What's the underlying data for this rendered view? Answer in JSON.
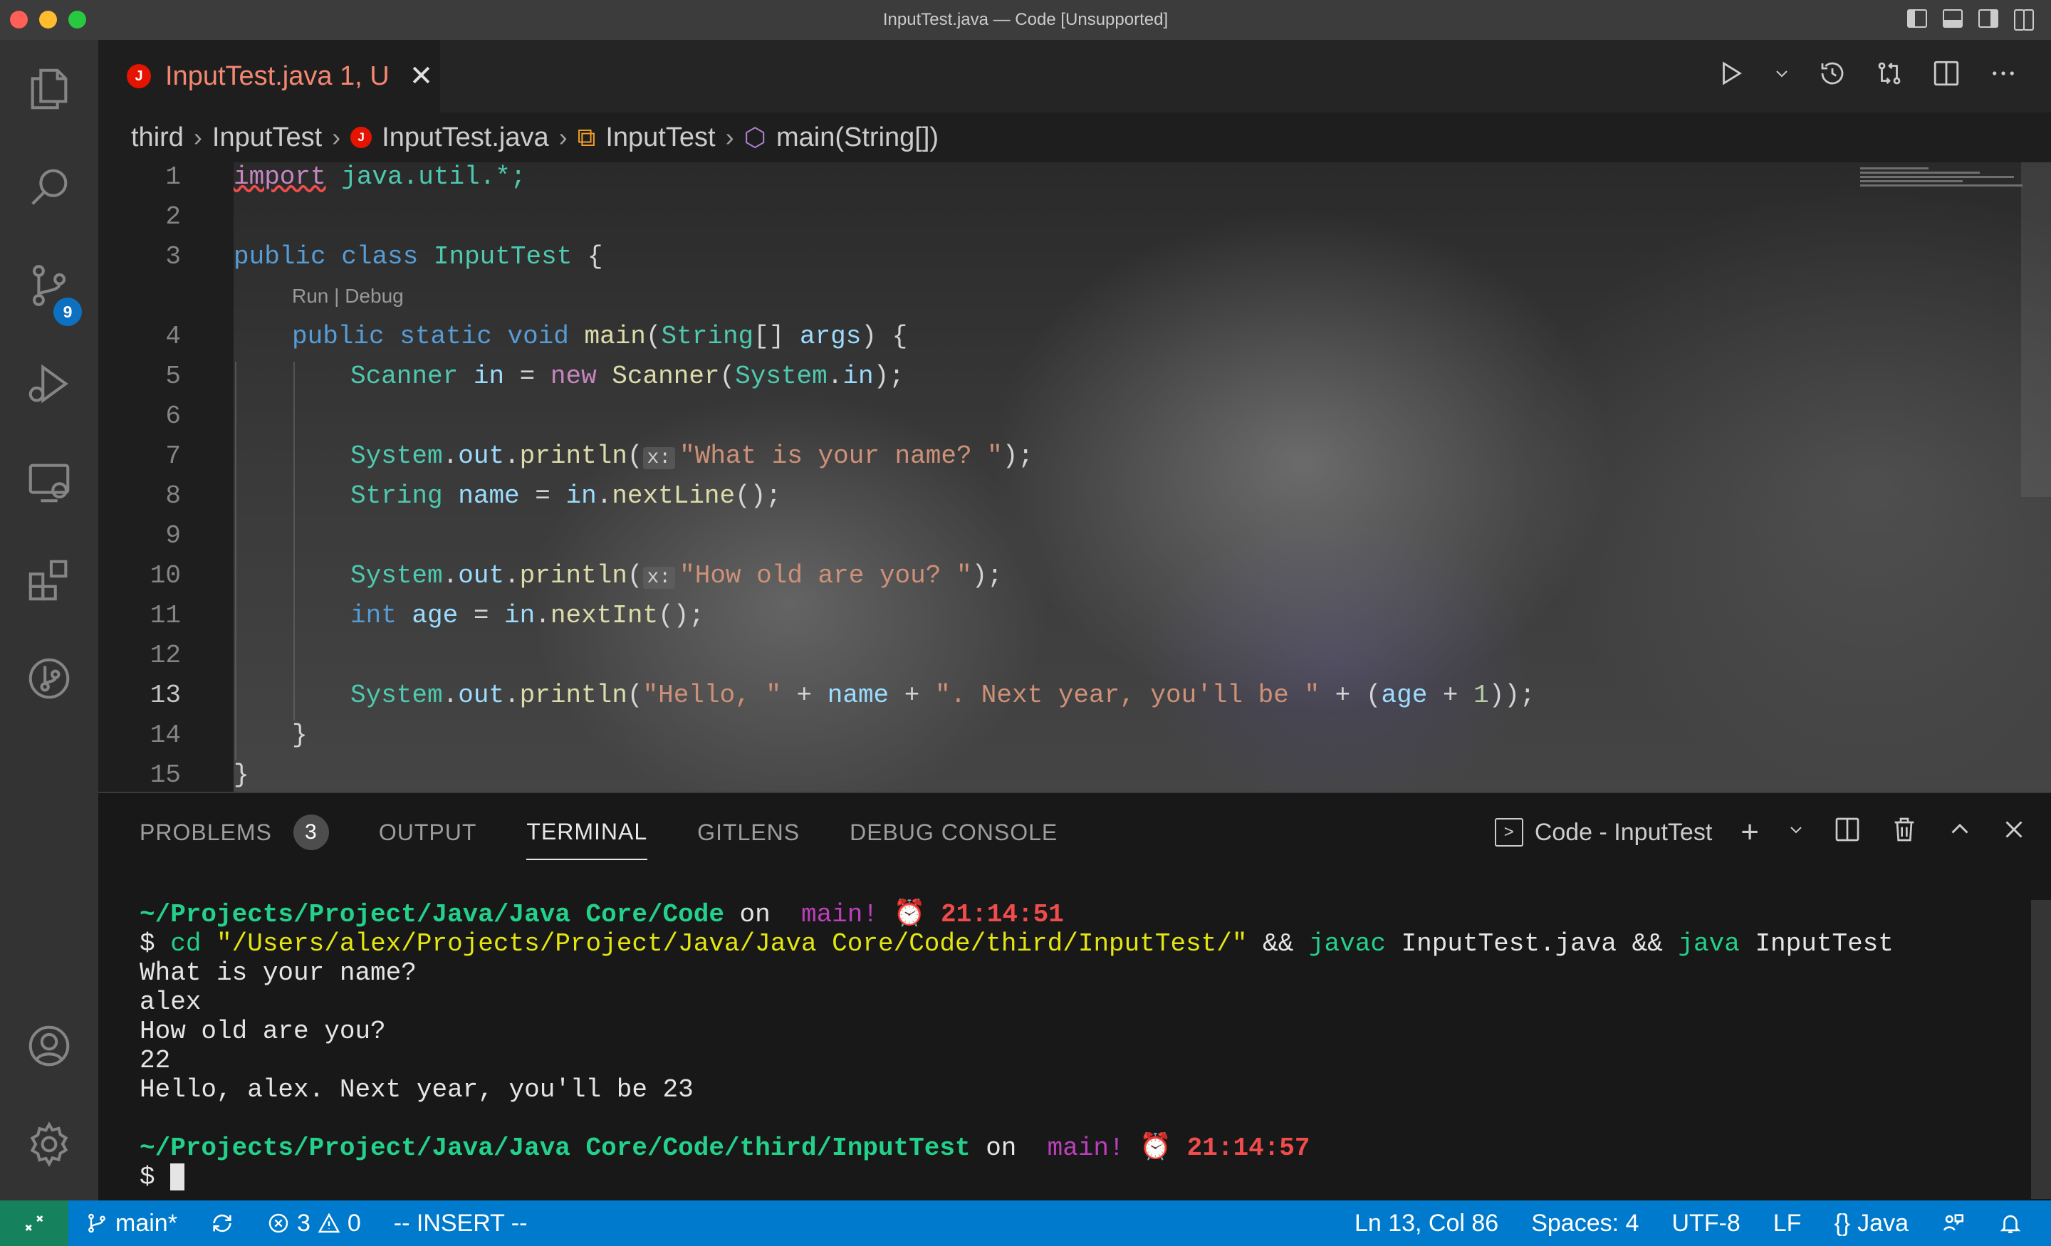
{
  "window": {
    "title": "InputTest.java — Code [Unsupported]"
  },
  "activity_bar": {
    "items": [
      {
        "name": "explorer-icon"
      },
      {
        "name": "search-icon"
      },
      {
        "name": "source-control-icon",
        "badge": "9"
      },
      {
        "name": "run-debug-icon"
      },
      {
        "name": "remote-explorer-icon"
      },
      {
        "name": "extensions-icon"
      },
      {
        "name": "gitlens-icon"
      },
      {
        "name": "account-icon"
      },
      {
        "name": "settings-gear-icon"
      }
    ]
  },
  "editor": {
    "tab": {
      "label": "InputTest.java",
      "suffix": "1, U",
      "icon_letter": "J",
      "close": "✕"
    },
    "breadcrumb": {
      "items": [
        "third",
        "InputTest",
        "InputTest.java",
        "InputTest",
        "main(String[])"
      ]
    },
    "codelens": "Run | Debug",
    "line_numbers": [
      "1",
      "2",
      "3",
      "4",
      "5",
      "6",
      "7",
      "8",
      "9",
      "10",
      "11",
      "12",
      "13",
      "14",
      "15"
    ],
    "active_line": "13",
    "lines": {
      "l1": {
        "kw": "import",
        "rest": " java.util.*;"
      },
      "l3": {
        "kw1": "public",
        "kw2": "class",
        "type": "InputTest",
        "rest": " {"
      },
      "l4": {
        "kw1": "public",
        "kw2": "static",
        "kw3": "void",
        "fn": "main",
        "p1": "(",
        "type": "String",
        "p2": "[] ",
        "var": "args",
        "p3": ") {"
      },
      "l5": {
        "type": "Scanner",
        "var": "in",
        "eq": " = ",
        "kw": "new",
        "type2": "Scanner",
        "p1": "(",
        "type3": "System",
        "dot": ".",
        "var2": "in",
        "p2": ");"
      },
      "l7": {
        "type": "System",
        "var": "out",
        "fn": "println",
        "hint": "x:",
        "str": "\"What is your name? \"",
        "end": ");"
      },
      "l8": {
        "type": "String",
        "var": "name",
        "eq": " = ",
        "var2": "in",
        "fn": "nextLine",
        "end": "();"
      },
      "l10": {
        "type": "System",
        "var": "out",
        "fn": "println",
        "hint": "x:",
        "str": "\"How old are you? \"",
        "end": ");"
      },
      "l11": {
        "kw": "int",
        "var": "age",
        "eq": " = ",
        "var2": "in",
        "fn": "nextInt",
        "end": "();"
      },
      "l13": {
        "type": "System",
        "var": "out",
        "fn": "println",
        "str1": "\"Hello, \"",
        "plus1": " + ",
        "var2": "name",
        "plus2": " + ",
        "str2": "\". Next year, you'll be \"",
        "plus3": " + (",
        "var3": "age",
        "plus4": " + ",
        "num": "1",
        "end": "));"
      },
      "l14": {
        "text": "}"
      },
      "l15": {
        "text": "}"
      }
    }
  },
  "panel": {
    "tabs": [
      {
        "label": "PROBLEMS",
        "badge": "3"
      },
      {
        "label": "OUTPUT"
      },
      {
        "label": "TERMINAL",
        "active": true
      },
      {
        "label": "GITLENS"
      },
      {
        "label": "DEBUG CONSOLE"
      }
    ],
    "terminal_name": "Code - InputTest",
    "terminal": {
      "prompt1": {
        "path": "~/Projects/Project/Java/Java Core/Code",
        "on": " on ",
        "branch_glyph": "",
        "branch": " main!",
        "clock": " ⏰ ",
        "time": "21:14:51"
      },
      "command": {
        "dollar": "$ ",
        "cd": "cd",
        "arg": " \"/Users/alex/Projects/Project/Java/Java Core/Code/third/InputTest/\"",
        "and1": " && ",
        "javac": "javac",
        "file": " InputTest.java",
        "and2": " && ",
        "java": "java",
        "cls": " InputTest"
      },
      "output": [
        "What is your name?",
        "alex",
        "How old are you?",
        "22",
        "Hello, alex. Next year, you'll be 23"
      ],
      "prompt2": {
        "path": "~/Projects/Project/Java/Java Core/Code/third/InputTest",
        "on": " on ",
        "branch_glyph": "",
        "branch": " main!",
        "clock": " ⏰ ",
        "time": "21:14:57"
      },
      "dollar": "$ "
    }
  },
  "status_bar": {
    "remote_icon": "remote-icon",
    "branch": "main*",
    "errors": "3",
    "warnings": "0",
    "mode": "-- INSERT --",
    "position": "Ln 13, Col 86",
    "spaces": "Spaces: 4",
    "encoding": "UTF-8",
    "eol": "LF",
    "language_icon": "{}",
    "language": "Java"
  },
  "colors": {
    "accent": "#007acc",
    "remote": "#16825d",
    "error_tab": "#f48771",
    "terminal_path": "#23d18b",
    "terminal_time": "#f14c4c"
  }
}
